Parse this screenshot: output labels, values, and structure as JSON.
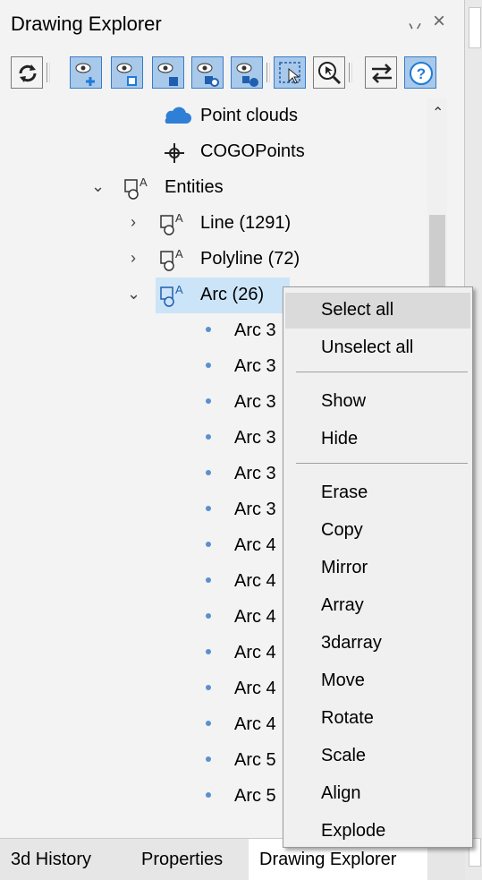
{
  "window": {
    "title": "Drawing Explorer",
    "pin_glyph": "丷",
    "close_glyph": "×"
  },
  "toolbar": {
    "buttons": [
      "refresh-icon",
      "show-add-icon",
      "show-outline-icon",
      "show-solid-icon",
      "show-rotated-icon",
      "show-filled-icon",
      "select-window-icon",
      "zoom-select-icon",
      "swap-icon",
      "help-icon"
    ]
  },
  "tree": {
    "items": [
      {
        "label": "Point clouds",
        "icon": "cloud-icon"
      },
      {
        "label": "COGOPoints",
        "icon": "crosshair-icon"
      },
      {
        "label": "Entities",
        "icon": "entities-icon",
        "expanded": true
      },
      {
        "label": "Line (1291)",
        "icon": "entities-icon",
        "expanded": false
      },
      {
        "label": "Polyline (72)",
        "icon": "entities-icon",
        "expanded": false
      },
      {
        "label": "Arc (26)",
        "icon": "entities-icon",
        "expanded": true,
        "selected": true
      }
    ],
    "arc_children": [
      "Arc 3",
      "Arc 3",
      "Arc 3",
      "Arc 3",
      "Arc 3",
      "Arc 3",
      "Arc 4",
      "Arc 4",
      "Arc 4",
      "Arc 4",
      "Arc 4",
      "Arc 4",
      "Arc 5",
      "Arc 5"
    ]
  },
  "context_menu": {
    "groups": [
      [
        "Select all",
        "Unselect all"
      ],
      [
        "Show",
        "Hide"
      ],
      [
        "Erase",
        "Copy",
        "Mirror",
        "Array",
        "3darray",
        "Move",
        "Rotate",
        "Scale",
        "Align",
        "Explode"
      ]
    ],
    "highlighted": "Select all"
  },
  "tabs": [
    {
      "label": "3d History",
      "active": false
    },
    {
      "label": "Properties",
      "active": false
    },
    {
      "label": "Drawing Explorer",
      "active": true
    }
  ],
  "colors": {
    "toolbar_button_blue": "#a9c9ea",
    "selection": "#cce4f7",
    "bullet": "#5a8fd0",
    "cloud": "#2f7fd6"
  }
}
